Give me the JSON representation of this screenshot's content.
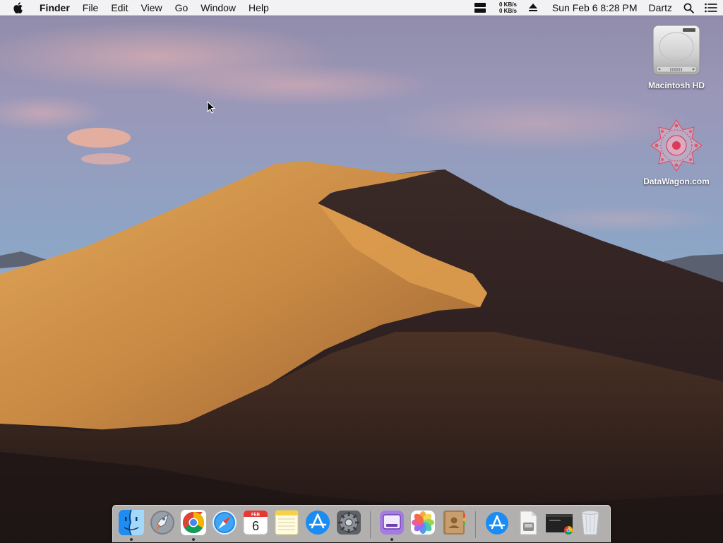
{
  "menubar": {
    "app_name": "Finder",
    "menus": [
      "File",
      "Edit",
      "View",
      "Go",
      "Window",
      "Help"
    ],
    "net_up": "0 KB/s",
    "net_down": "0 KB/s",
    "clock": "Sun Feb 6  8:28 PM",
    "user": "Dartz"
  },
  "desktop": {
    "icons": [
      {
        "label": "Macintosh HD",
        "icon": "hard-drive-icon"
      },
      {
        "label": "DataWagon.com",
        "icon": "datawagon-icon"
      }
    ]
  },
  "dock": {
    "apps": [
      {
        "icon": "finder-icon",
        "running": true
      },
      {
        "icon": "launchpad-icon",
        "running": false
      },
      {
        "icon": "chrome-icon",
        "running": true
      },
      {
        "icon": "safari-icon",
        "running": false
      },
      {
        "icon": "calendar-icon",
        "running": false,
        "month": "FEB",
        "day": "6"
      },
      {
        "icon": "notes-icon",
        "running": false
      },
      {
        "icon": "app-store-icon",
        "running": false
      },
      {
        "icon": "system-preferences-icon",
        "running": false
      },
      {
        "icon": "purple-app-icon",
        "running": true
      },
      {
        "icon": "photos-icon",
        "running": false
      },
      {
        "icon": "contacts-icon",
        "running": false
      }
    ],
    "stacks": [
      {
        "icon": "app-store-downloads-icon"
      },
      {
        "icon": "document-stack-icon"
      },
      {
        "icon": "chrome-window-stack-icon"
      },
      {
        "icon": "trash-icon"
      }
    ]
  },
  "colors": {
    "sky_top": "#8a8fb0",
    "sky_mid": "#8ea6c8",
    "dune_light": "#d79a4e",
    "dune_dark": "#2a1d1a",
    "menubar_bg": "#f6f6f6"
  }
}
